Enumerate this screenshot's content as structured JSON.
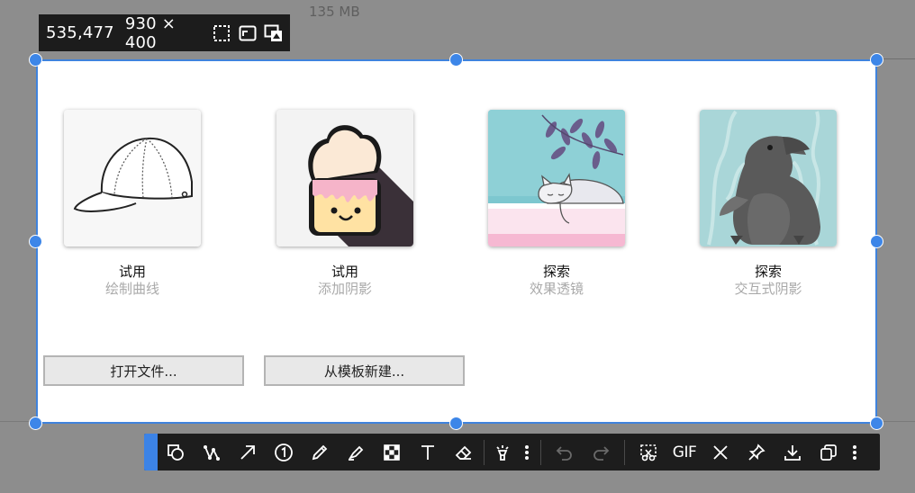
{
  "background": {
    "file_size": "135 MB"
  },
  "info_bar": {
    "coords": "535,477",
    "size": "930 × 400",
    "icons": [
      "region-select-icon",
      "window-select-icon",
      "screen-select-icon"
    ]
  },
  "start_page": {
    "cards": [
      {
        "title": "试用",
        "subtitle": "绘制曲线",
        "thumbnail": "baseball-cap-drawing"
      },
      {
        "title": "试用",
        "subtitle": "添加阴影",
        "thumbnail": "cupcake-with-shadow"
      },
      {
        "title": "探索",
        "subtitle": "效果透镜",
        "thumbnail": "sleeping-cat-illustration"
      },
      {
        "title": "探索",
        "subtitle": "交互式阴影",
        "thumbnail": "raven-papercut"
      }
    ],
    "buttons": {
      "open_file": "打开文件...",
      "new_from_template": "从模板新建..."
    }
  },
  "toolbar": {
    "accent_color": "#3c83e6",
    "tools": [
      "shape-icon",
      "curve-icon",
      "arrow-icon",
      "number-marker-icon",
      "pencil-icon",
      "highlighter-icon",
      "mosaic-icon",
      "text-icon",
      "eraser-icon",
      "spotlight-icon",
      "more-icon",
      "undo-icon",
      "redo-icon",
      "cut-icon",
      "gif-icon",
      "close-icon",
      "pin-icon",
      "download-icon",
      "copy-icon",
      "more-icon"
    ],
    "gif_label": "GIF"
  },
  "colors": {
    "selection_border": "#3f83dd",
    "handle": "#3d86e8",
    "toolbar_bg": "#1d1d1d"
  }
}
